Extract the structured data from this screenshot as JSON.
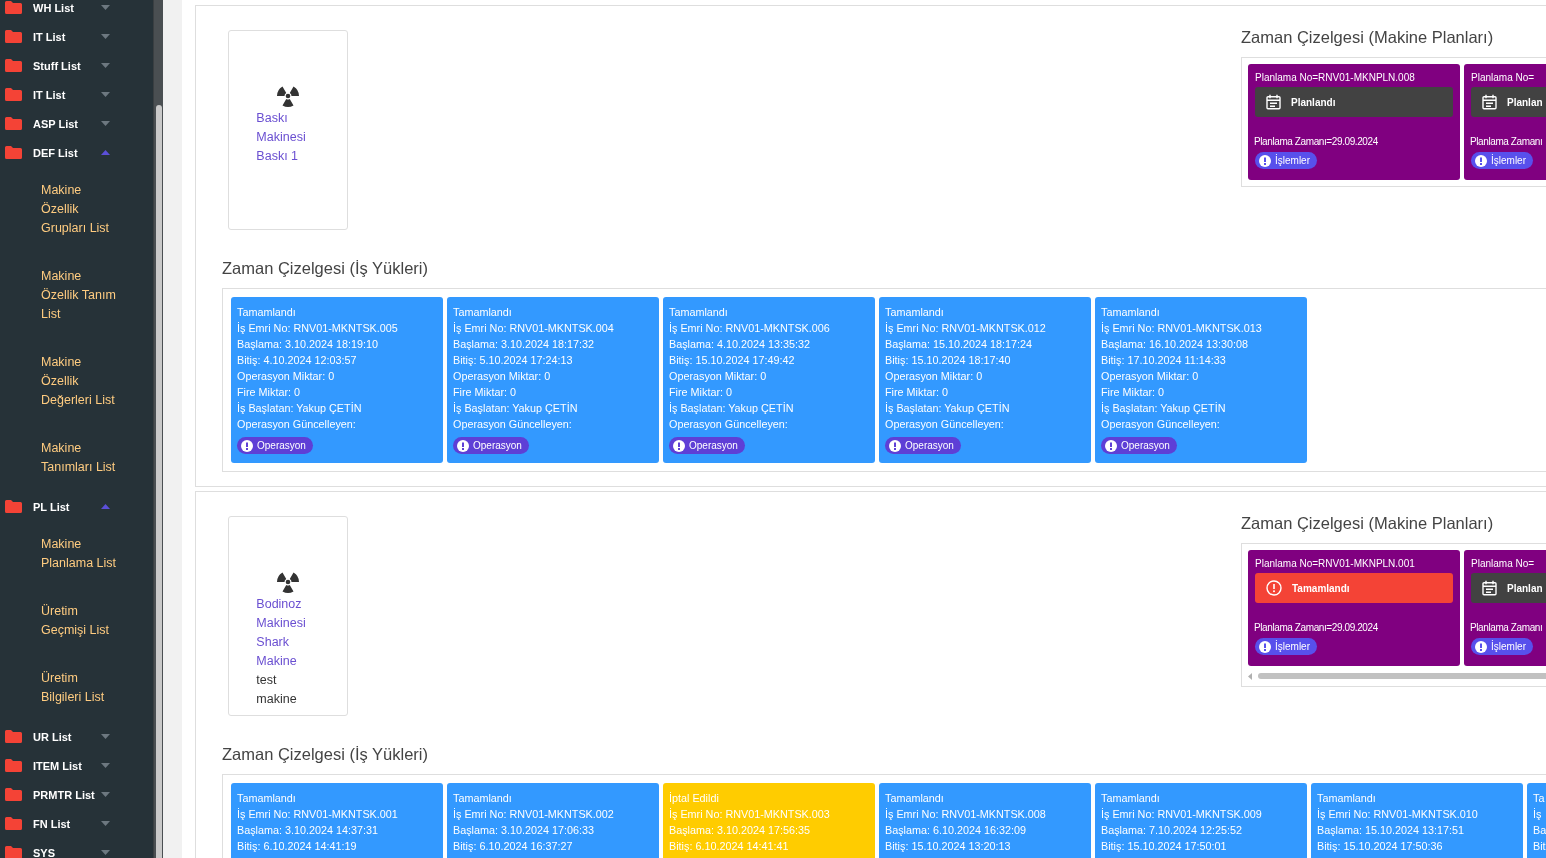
{
  "sidebar": {
    "items": [
      {
        "label": "WH List",
        "expanded": false
      },
      {
        "label": "IT List",
        "expanded": false
      },
      {
        "label": "Stuff List",
        "expanded": false
      },
      {
        "label": "IT List",
        "expanded": false
      },
      {
        "label": "ASP List",
        "expanded": false
      },
      {
        "label": "DEF List",
        "expanded": true,
        "children": [
          {
            "label": "Makine Özellik Grupları List"
          },
          {
            "label": "Makine Özellik Tanım List"
          },
          {
            "label": "Makine Özellik Değerleri List"
          },
          {
            "label": "Makine Tanımları List"
          }
        ]
      },
      {
        "label": "PL List",
        "expanded": true,
        "children": [
          {
            "label": "Makine Planlama List"
          },
          {
            "label": "Üretim Geçmişi List"
          },
          {
            "label": "Üretim Bilgileri List"
          }
        ]
      },
      {
        "label": "UR List",
        "expanded": false
      },
      {
        "label": "ITEM List",
        "expanded": false
      },
      {
        "label": "PRMTR List",
        "expanded": false
      },
      {
        "label": "FN List",
        "expanded": false
      },
      {
        "label": "SYS",
        "expanded": false
      }
    ]
  },
  "machines": [
    {
      "machine_card": {
        "texts": [
          {
            "text": "Baskı Makinesi Baskı 1",
            "kind": "link"
          }
        ]
      },
      "plans": {
        "title": "Zaman Çizelgesi (Makine Planları)",
        "horizontal_scrollbar": false,
        "items": [
          {
            "number": "Planlama No=RNV01-MKNPLN.008",
            "status": "Planlandı",
            "kind": "planned",
            "time": "Planlama Zamanı=29.09.2024",
            "action": "İşlemler"
          },
          {
            "number": "Planlama No=",
            "status": "Planlan",
            "kind": "planned",
            "time": "Planlama Zamanı",
            "action": "İşlemler"
          }
        ]
      },
      "tasks": {
        "title": "Zaman Çizelgesi (İş Yükleri)",
        "items": [
          {
            "status": "Tamamlandı",
            "kind": "completed",
            "lines": [
              "İş Emri No: RNV01-MKNTSK.005",
              "Başlama: 3.10.2024 18:19:10",
              "Bitiş: 4.10.2024 12:03:57",
              "Operasyon Miktar: 0",
              "Fire Miktar: 0",
              "İş Başlatan: Yakup ÇETİN",
              "Operasyon Güncelleyen:"
            ],
            "action": "Operasyon"
          },
          {
            "status": "Tamamlandı",
            "kind": "completed",
            "lines": [
              "İş Emri No: RNV01-MKNTSK.004",
              "Başlama: 3.10.2024 18:17:32",
              "Bitiş: 5.10.2024 17:24:13",
              "Operasyon Miktar: 0",
              "Fire Miktar: 0",
              "İş Başlatan: Yakup ÇETİN",
              "Operasyon Güncelleyen:"
            ],
            "action": "Operasyon"
          },
          {
            "status": "Tamamlandı",
            "kind": "completed",
            "lines": [
              "İş Emri No: RNV01-MKNTSK.006",
              "Başlama: 4.10.2024 13:35:32",
              "Bitiş: 15.10.2024 17:49:42",
              "Operasyon Miktar: 0",
              "Fire Miktar: 0",
              "İş Başlatan: Yakup ÇETİN",
              "Operasyon Güncelleyen:"
            ],
            "action": "Operasyon"
          },
          {
            "status": "Tamamlandı",
            "kind": "completed",
            "lines": [
              "İş Emri No: RNV01-MKNTSK.012",
              "Başlama: 15.10.2024 18:17:24",
              "Bitiş: 15.10.2024 18:17:40",
              "Operasyon Miktar: 0",
              "Fire Miktar: 0",
              "İş Başlatan: Yakup ÇETİN",
              "Operasyon Güncelleyen:"
            ],
            "action": "Operasyon"
          },
          {
            "status": "Tamamlandı",
            "kind": "completed",
            "lines": [
              "İş Emri No: RNV01-MKNTSK.013",
              "Başlama: 16.10.2024 13:30:08",
              "Bitiş: 17.10.2024 11:14:33",
              "Operasyon Miktar: 0",
              "Fire Miktar: 0",
              "İş Başlatan: Yakup ÇETİN",
              "Operasyon Güncelleyen:"
            ],
            "action": "Operasyon"
          }
        ]
      }
    },
    {
      "machine_card": {
        "texts": [
          {
            "text": "Bodinoz Makinesi Shark Makine",
            "kind": "link"
          },
          {
            "text": "test makine",
            "kind": "plain"
          }
        ]
      },
      "plans": {
        "title": "Zaman Çizelgesi (Makine Planları)",
        "horizontal_scrollbar": true,
        "items": [
          {
            "number": "Planlama No=RNV01-MKNPLN.001",
            "status": "Tamamlandı",
            "kind": "completed",
            "time": "Planlama Zamanı=29.09.2024",
            "action": "İşlemler"
          },
          {
            "number": "Planlama No=",
            "status": "Planlan",
            "kind": "planned",
            "time": "Planlama Zamanı",
            "action": "İşlemler"
          }
        ]
      },
      "tasks": {
        "title": "Zaman Çizelgesi (İş Yükleri)",
        "items": [
          {
            "status": "Tamamlandı",
            "kind": "completed",
            "lines": [
              "İş Emri No: RNV01-MKNTSK.001",
              "Başlama: 3.10.2024 14:37:31",
              "Bitiş: 6.10.2024 14:41:19"
            ]
          },
          {
            "status": "Tamamlandı",
            "kind": "completed",
            "lines": [
              "İş Emri No: RNV01-MKNTSK.002",
              "Başlama: 3.10.2024 17:06:33",
              "Bitiş: 6.10.2024 16:37:27"
            ]
          },
          {
            "status": "İptal Edildi",
            "kind": "cancelled",
            "lines": [
              "İş Emri No: RNV01-MKNTSK.003",
              "Başlama: 3.10.2024 17:56:35",
              "Bitiş: 6.10.2024 14:41:41"
            ]
          },
          {
            "status": "Tamamlandı",
            "kind": "completed",
            "lines": [
              "İş Emri No: RNV01-MKNTSK.008",
              "Başlama: 6.10.2024 16:32:09",
              "Bitiş: 15.10.2024 13:20:13"
            ]
          },
          {
            "status": "Tamamlandı",
            "kind": "completed",
            "lines": [
              "İş Emri No: RNV01-MKNTSK.009",
              "Başlama: 7.10.2024 12:25:52",
              "Bitiş: 15.10.2024 17:50:01"
            ]
          },
          {
            "status": "Tamamlandı",
            "kind": "completed",
            "lines": [
              "İş Emri No: RNV01-MKNTSK.010",
              "Başlama: 15.10.2024 13:17:51",
              "Bitiş: 15.10.2024 17:50:36"
            ]
          },
          {
            "status": "Ta",
            "kind": "completed",
            "lines": [
              "İş",
              "Ba",
              "Bit"
            ]
          }
        ]
      }
    }
  ]
}
